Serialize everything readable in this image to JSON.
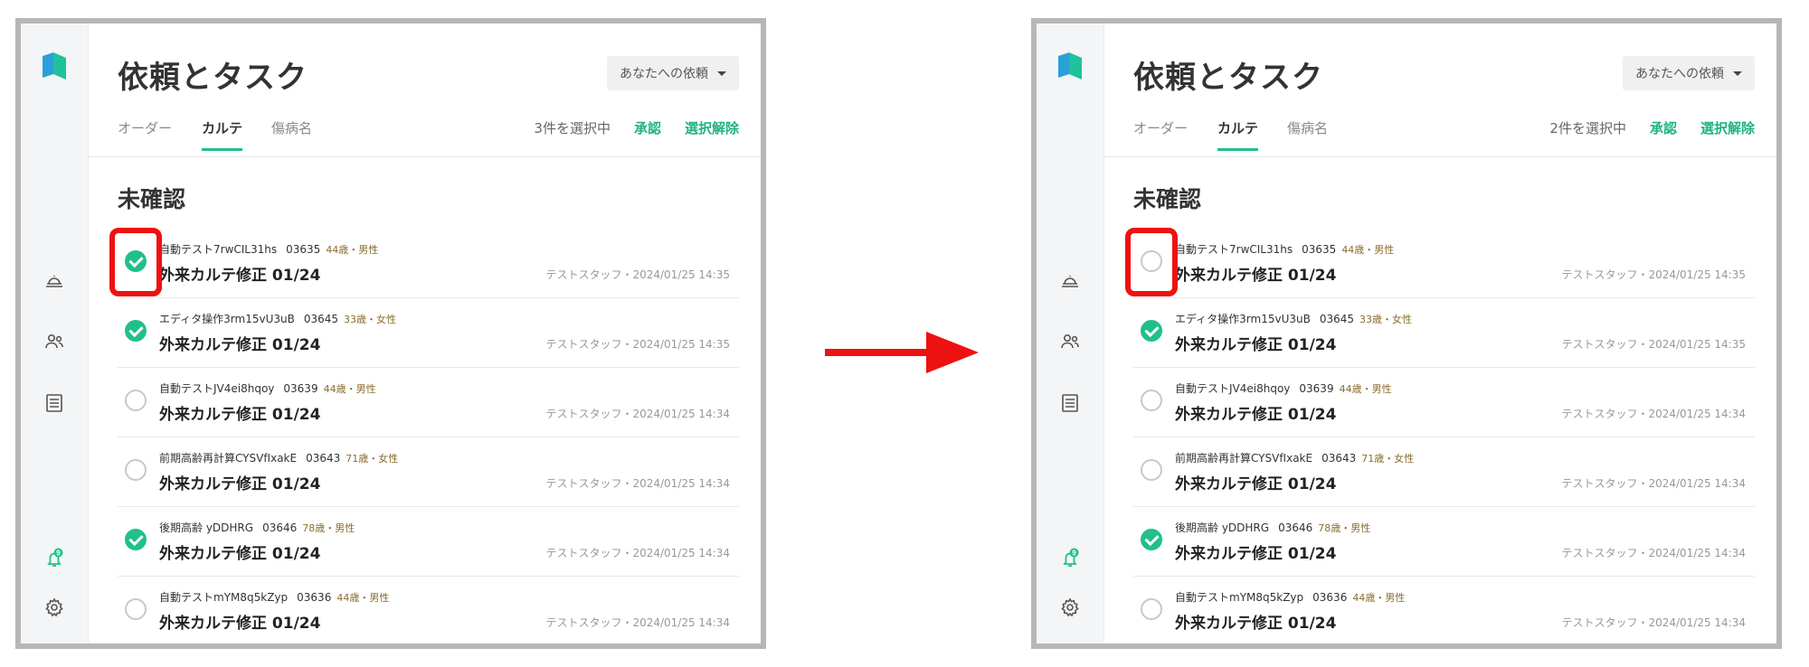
{
  "colors": {
    "accent": "#20c088",
    "highlight": "#ee1111",
    "arrow": "#ee1111"
  },
  "app": {
    "title": "依頼とタスク",
    "filter_label": "あなたへの依頼",
    "tabs": [
      "オーダー",
      "カルテ",
      "傷病名"
    ],
    "active_tab": "カルテ",
    "approve_label": "承認",
    "clear_label": "選択解除",
    "section_title": "未確認",
    "notification_count": "9"
  },
  "sidebar_icons": [
    "logo-icon",
    "bell-tray-icon",
    "users-icon",
    "list-icon",
    "notification-bell-icon",
    "gear-icon"
  ],
  "panels": [
    {
      "selected_count": "3件を選択中",
      "rows": [
        {
          "name": "自動テスト7rwCIL31hs",
          "id": "03635",
          "demo": "44歳・男性",
          "task": "外来カルテ修正 01/24",
          "meta": "テストスタッフ・2024/01/25 14:35",
          "checked": true,
          "highlighted": true
        },
        {
          "name": "エディタ操作3rm15vU3uB",
          "id": "03645",
          "demo": "33歳・女性",
          "task": "外来カルテ修正 01/24",
          "meta": "テストスタッフ・2024/01/25 14:35",
          "checked": true,
          "highlighted": false
        },
        {
          "name": "自動テストJV4ei8hqoy",
          "id": "03639",
          "demo": "44歳・男性",
          "task": "外来カルテ修正 01/24",
          "meta": "テストスタッフ・2024/01/25 14:34",
          "checked": false,
          "highlighted": false
        },
        {
          "name": "前期高齢再計算CYSVfIxakE",
          "id": "03643",
          "demo": "71歳・女性",
          "task": "外来カルテ修正 01/24",
          "meta": "テストスタッフ・2024/01/25 14:34",
          "checked": false,
          "highlighted": false
        },
        {
          "name": "後期高齢 yDDHRG",
          "id": "03646",
          "demo": "78歳・男性",
          "task": "外来カルテ修正 01/24",
          "meta": "テストスタッフ・2024/01/25 14:34",
          "checked": true,
          "highlighted": false
        },
        {
          "name": "自動テストmYM8q5kZyp",
          "id": "03636",
          "demo": "44歳・男性",
          "task": "外来カルテ修正 01/24",
          "meta": "テストスタッフ・2024/01/25 14:34",
          "checked": false,
          "highlighted": false
        }
      ]
    },
    {
      "selected_count": "2件を選択中",
      "rows": [
        {
          "name": "自動テスト7rwCIL31hs",
          "id": "03635",
          "demo": "44歳・男性",
          "task": "外来カルテ修正 01/24",
          "meta": "テストスタッフ・2024/01/25 14:35",
          "checked": false,
          "highlighted": true
        },
        {
          "name": "エディタ操作3rm15vU3uB",
          "id": "03645",
          "demo": "33歳・女性",
          "task": "外来カルテ修正 01/24",
          "meta": "テストスタッフ・2024/01/25 14:35",
          "checked": true,
          "highlighted": false
        },
        {
          "name": "自動テストJV4ei8hqoy",
          "id": "03639",
          "demo": "44歳・男性",
          "task": "外来カルテ修正 01/24",
          "meta": "テストスタッフ・2024/01/25 14:34",
          "checked": false,
          "highlighted": false
        },
        {
          "name": "前期高齢再計算CYSVfIxakE",
          "id": "03643",
          "demo": "71歳・女性",
          "task": "外来カルテ修正 01/24",
          "meta": "テストスタッフ・2024/01/25 14:34",
          "checked": false,
          "highlighted": false
        },
        {
          "name": "後期高齢 yDDHRG",
          "id": "03646",
          "demo": "78歳・男性",
          "task": "外来カルテ修正 01/24",
          "meta": "テストスタッフ・2024/01/25 14:34",
          "checked": true,
          "highlighted": false
        },
        {
          "name": "自動テストmYM8q5kZyp",
          "id": "03636",
          "demo": "44歳・男性",
          "task": "外来カルテ修正 01/24",
          "meta": "テストスタッフ・2024/01/25 14:34",
          "checked": false,
          "highlighted": false
        }
      ]
    }
  ]
}
